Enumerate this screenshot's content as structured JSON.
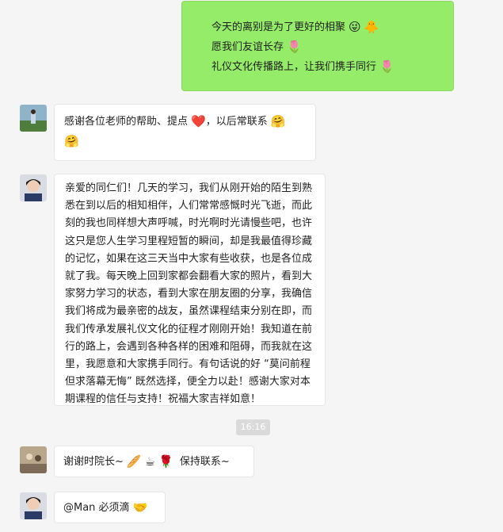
{
  "messages": [
    {
      "sender": "self",
      "lines": [
        {
          "text": "今天的离别是为了更好的相聚",
          "emojis": [
            "😜",
            "🐥"
          ]
        },
        {
          "text": "愿我们友谊长存",
          "emojis": [
            "🌷"
          ]
        },
        {
          "text": "礼仪文化传播路上，让我们携手同行",
          "emojis": [
            "🌷"
          ]
        }
      ]
    },
    {
      "sender": "other",
      "text_a": "感谢各位老师的帮助、提点",
      "emoji_a": "❤️",
      "text_b": "，以后常联系",
      "emoji_b": "🤗",
      "emoji_c": "🤗"
    },
    {
      "sender": "other",
      "paragraph": "亲爱的同仁们！几天的学习，我们从刚开始的陌生到熟悉在到以后的相知相伴，人们常常感慨时光飞逝，而此刻的我也同样想大声呼喊，时光啊时光请慢些吧，也许这只是您人生学习里程短暂的瞬间，却是我最值得珍藏的记忆，如果在这三天当中大家有些收获，也是各位成就了我。每天晚上回到家都会翻看大家的照片，看到大家努力学习的状态，看到大家在朋友圈的分享，我确信我们将成为最亲密的战友，虽然课程结束分别在即，而我们传承发展礼仪文化的征程才刚刚开始！我知道在前行的路上，会遇到各种各样的困难和阻碍，而我就在这里，我愿意和大家携手同行。有句话说的好 “莫问前程但求落幕无悔” 既然选择，便全力以赴！感谢大家对本期课程的信任与支持！祝福大家吉祥如意！"
    },
    {
      "sender": "other",
      "text": "谢谢时院长~",
      "emojis": [
        "🥖",
        "☕",
        "🌹"
      ],
      "text_after": "保持联系~"
    },
    {
      "sender": "other",
      "text": "@Man 必须滴",
      "emojis": [
        "🤝"
      ]
    }
  ],
  "timestamp": "16:16",
  "colors": {
    "self_bubble": "#95ec69",
    "other_bubble": "#ffffff",
    "background": "#f5f5f5"
  }
}
